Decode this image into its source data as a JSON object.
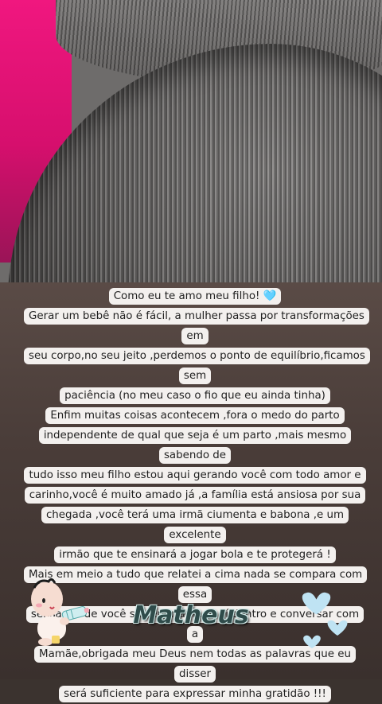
{
  "story": {
    "lines": [
      "Como eu te amo meu filho! 🩵",
      "Gerar um bebê não é fácil, a mulher passa por transformações em",
      "seu corpo,no seu jeito ,perdemos o ponto de equilíbrio,ficamos sem",
      "paciência (no meu caso o fio que eu ainda tinha)",
      "Enfim muitas coisas acontecem ,fora o medo do parto",
      "independente de qual que seja é um parto ,mais mesmo sabendo de",
      "tudo isso meu filho estou aqui gerando você com todo amor e",
      "carinho,você é muito amado já ,a família está ansiosa por sua",
      "chegada ,você terá uma irmã ciumenta e babona ,e um excelente",
      "irmão que te ensinará a jogar bola e te protegerá !",
      "Mais em meio a tudo que relatei a cima nada se compara com essa",
      "sensação de você se sentir amado aí dentro e conversar com a",
      "Mamãe,obrigada meu Deus nem todas as palavras que eu disser",
      "será suficiente para expressar minha gratidão !!!"
    ],
    "name_sticker": "Matheus"
  },
  "colors": {
    "text_bg": "#f3f0ee",
    "heart": "#bfe3f3",
    "pink": "#f0177f"
  },
  "stickers": {
    "baby": "baby-bottle-sticker",
    "hearts": "blue-hearts-sticker"
  }
}
